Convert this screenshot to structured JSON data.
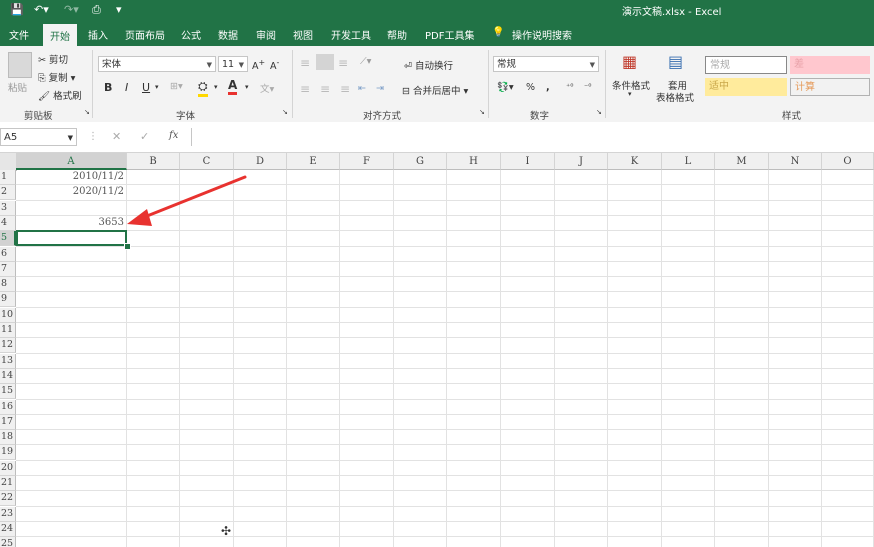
{
  "title": "演示文稿.xlsx  -  Excel",
  "tabs": [
    "文件",
    "开始",
    "插入",
    "页面布局",
    "公式",
    "数据",
    "审阅",
    "视图",
    "开发工具",
    "帮助",
    "PDF工具集"
  ],
  "tell_me": "操作说明搜索",
  "clipboard": {
    "paste": "粘贴",
    "cut": "剪切",
    "copy": "复制",
    "format_painter": "格式刷",
    "label": "剪贴板"
  },
  "font": {
    "name": "宋体",
    "size": "11",
    "label": "字体",
    "bold": "B",
    "italic": "I",
    "underline": "U"
  },
  "alignment": {
    "wrap": "自动换行",
    "merge": "合并后居中",
    "label": "对齐方式"
  },
  "number": {
    "format": "常规",
    "percent": "%",
    "comma": ",",
    "label": "数字"
  },
  "styles": {
    "conditional": "条件格式",
    "table1": "套用",
    "table2": "表格格式",
    "normal": "常规",
    "bad": "差",
    "neutral": "适中",
    "calc": "计算",
    "label": "样式"
  },
  "name_box": "A5",
  "fx": "fx",
  "columns": [
    "A",
    "B",
    "C",
    "D",
    "E",
    "F",
    "G",
    "H",
    "I",
    "J",
    "K",
    "L",
    "M",
    "N",
    "O"
  ],
  "rows": [
    "1",
    "2",
    "3",
    "4",
    "5",
    "6",
    "7",
    "8",
    "9",
    "10",
    "11",
    "12",
    "13",
    "14",
    "15",
    "16",
    "17",
    "18",
    "19",
    "20",
    "21",
    "22",
    "23",
    "24",
    "25"
  ],
  "cells": {
    "A1": "2010/11/2",
    "A2": "2020/11/2",
    "A4": "3653"
  },
  "colors": {
    "accent": "#217346",
    "arrow": "#e8322f"
  }
}
